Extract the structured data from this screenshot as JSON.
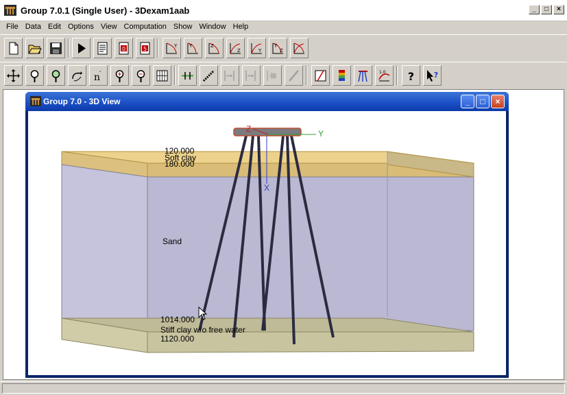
{
  "app": {
    "title": "Group 7.0.1 (Single User) - 3Dexam1aab",
    "min_glyph": "_",
    "max_glyph": "□",
    "close_glyph": "×"
  },
  "menu": [
    "File",
    "Data",
    "Edit",
    "Options",
    "View",
    "Computation",
    "Show",
    "Window",
    "Help"
  ],
  "toolbar1": [
    {
      "icon": "new-file-icon"
    },
    {
      "icon": "open-folder-icon"
    },
    {
      "icon": "save-disk-icon"
    },
    {
      "icon": "run-play-icon"
    },
    {
      "icon": "output-page-icon"
    },
    {
      "icon": "report-0-icon"
    },
    {
      "icon": "report-5-icon"
    },
    {
      "icon": "yx-displacement-icon"
    },
    {
      "icon": "yx-rotation-icon"
    },
    {
      "icon": "zx-displacement-icon"
    },
    {
      "icon": "xz-displacement-icon"
    },
    {
      "icon": "zy-displacement-icon"
    },
    {
      "icon": "yz-rotation-icon"
    },
    {
      "icon": "zyx-icon"
    }
  ],
  "toolbar2": [
    {
      "icon": "pan-move-icon"
    },
    {
      "icon": "zoom-in-icon"
    },
    {
      "icon": "zoom-fit-icon"
    },
    {
      "icon": "rotate-icon"
    },
    {
      "icon": "node-icon"
    },
    {
      "icon": "zoom-plus-icon"
    },
    {
      "icon": "zoom-minus-icon"
    },
    {
      "icon": "grid-view-icon"
    },
    {
      "icon": "pile-head-icon"
    },
    {
      "icon": "pile-link-icon"
    },
    {
      "icon": "pile-force-icon"
    },
    {
      "icon": "pile-moment-icon"
    },
    {
      "icon": "pile-spring-icon"
    },
    {
      "icon": "pile-slope-icon"
    },
    {
      "icon": "batter-icon"
    },
    {
      "icon": "color-legend-icon"
    },
    {
      "icon": "pile-group-icon"
    },
    {
      "icon": "soil-profile-icon"
    },
    {
      "icon": "help-icon"
    },
    {
      "icon": "context-help-icon"
    }
  ],
  "child_window": {
    "title": "Group 7.0 - 3D View",
    "min_glyph": "_",
    "max_glyph": "□",
    "close_glyph": "×"
  },
  "view3d": {
    "axes": {
      "z": "Z",
      "y": "Y",
      "x": "X"
    },
    "layers": [
      {
        "name": "Soft clay",
        "top": "120.000",
        "bottom": "180.000",
        "color": "#e8c870"
      },
      {
        "name": "Sand",
        "color": "#b9b7d0"
      },
      {
        "name": "Stiff clay w/o free water",
        "top": "1014.000",
        "bottom": "1120.000",
        "color": "#c8c4a0"
      }
    ],
    "pile_color": "#2b2b40",
    "cap_color": "#7a7a80"
  },
  "status": {
    "text": ""
  }
}
